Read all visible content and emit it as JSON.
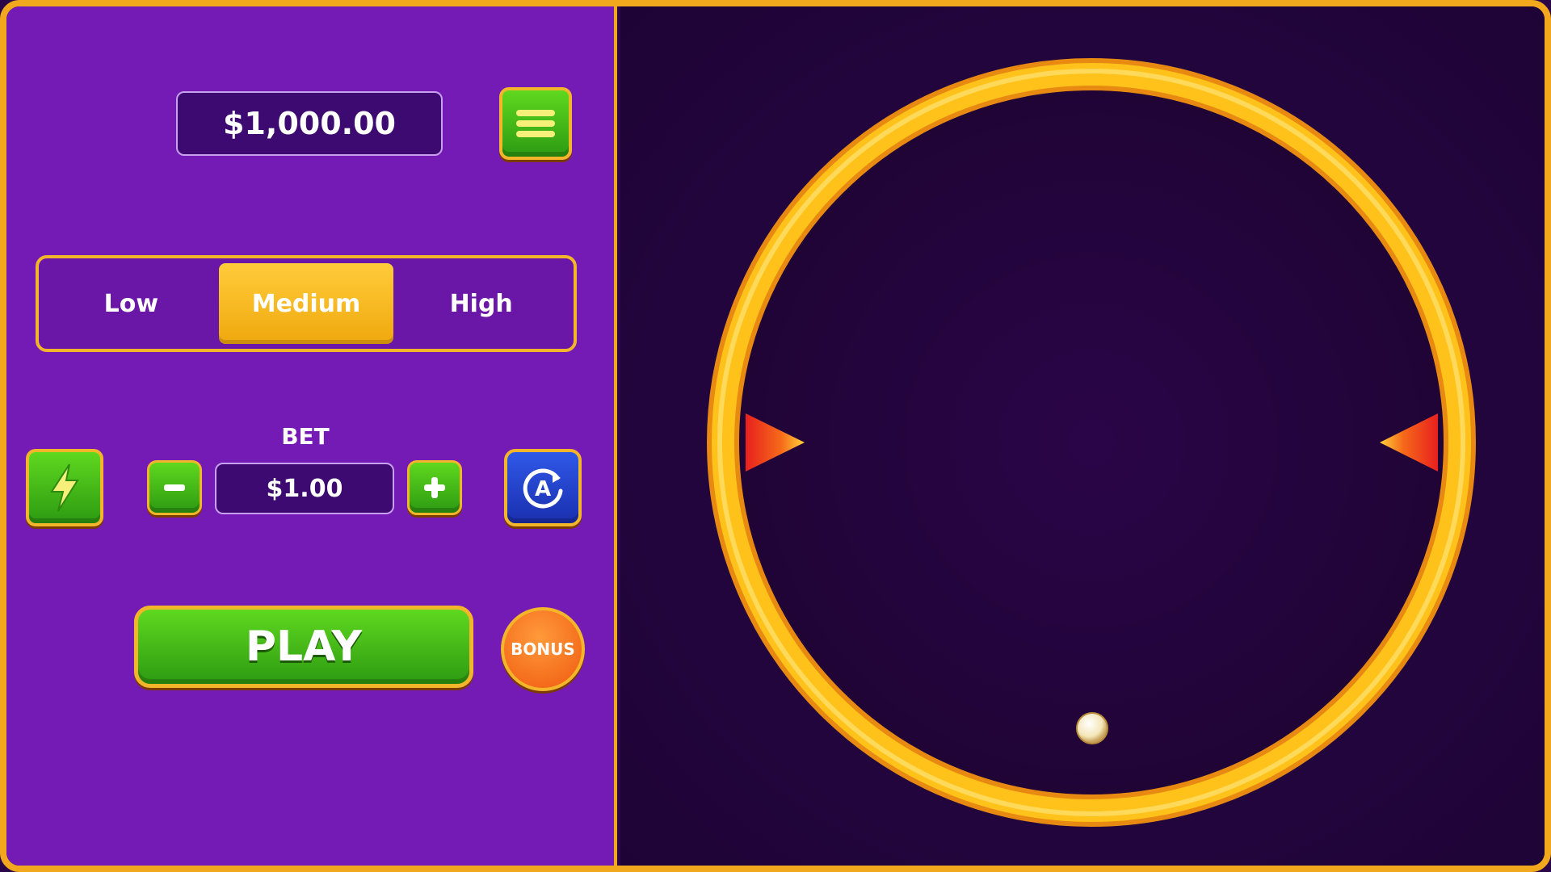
{
  "balance": {
    "amount": "$1,000.00"
  },
  "menu": {
    "icon": "hamburger-menu-icon"
  },
  "risk": {
    "options": [
      "Low",
      "Medium",
      "High"
    ],
    "selected": "Medium"
  },
  "bet": {
    "label": "BET",
    "value": "$1.00",
    "decrease_icon": "minus-icon",
    "increase_icon": "plus-icon"
  },
  "turbo": {
    "icon": "lightning-bolt-icon"
  },
  "autoplay": {
    "icon": "auto-rotate-icon",
    "letter": "A"
  },
  "play": {
    "label": "PLAY"
  },
  "bonus": {
    "label": "BONUS"
  },
  "colors": {
    "panel": "#741bb6",
    "arena": "#2a0848",
    "gold": "#f2a81d",
    "green": "#3cb817",
    "blue": "#2440d0",
    "orange": "#f05a10"
  }
}
